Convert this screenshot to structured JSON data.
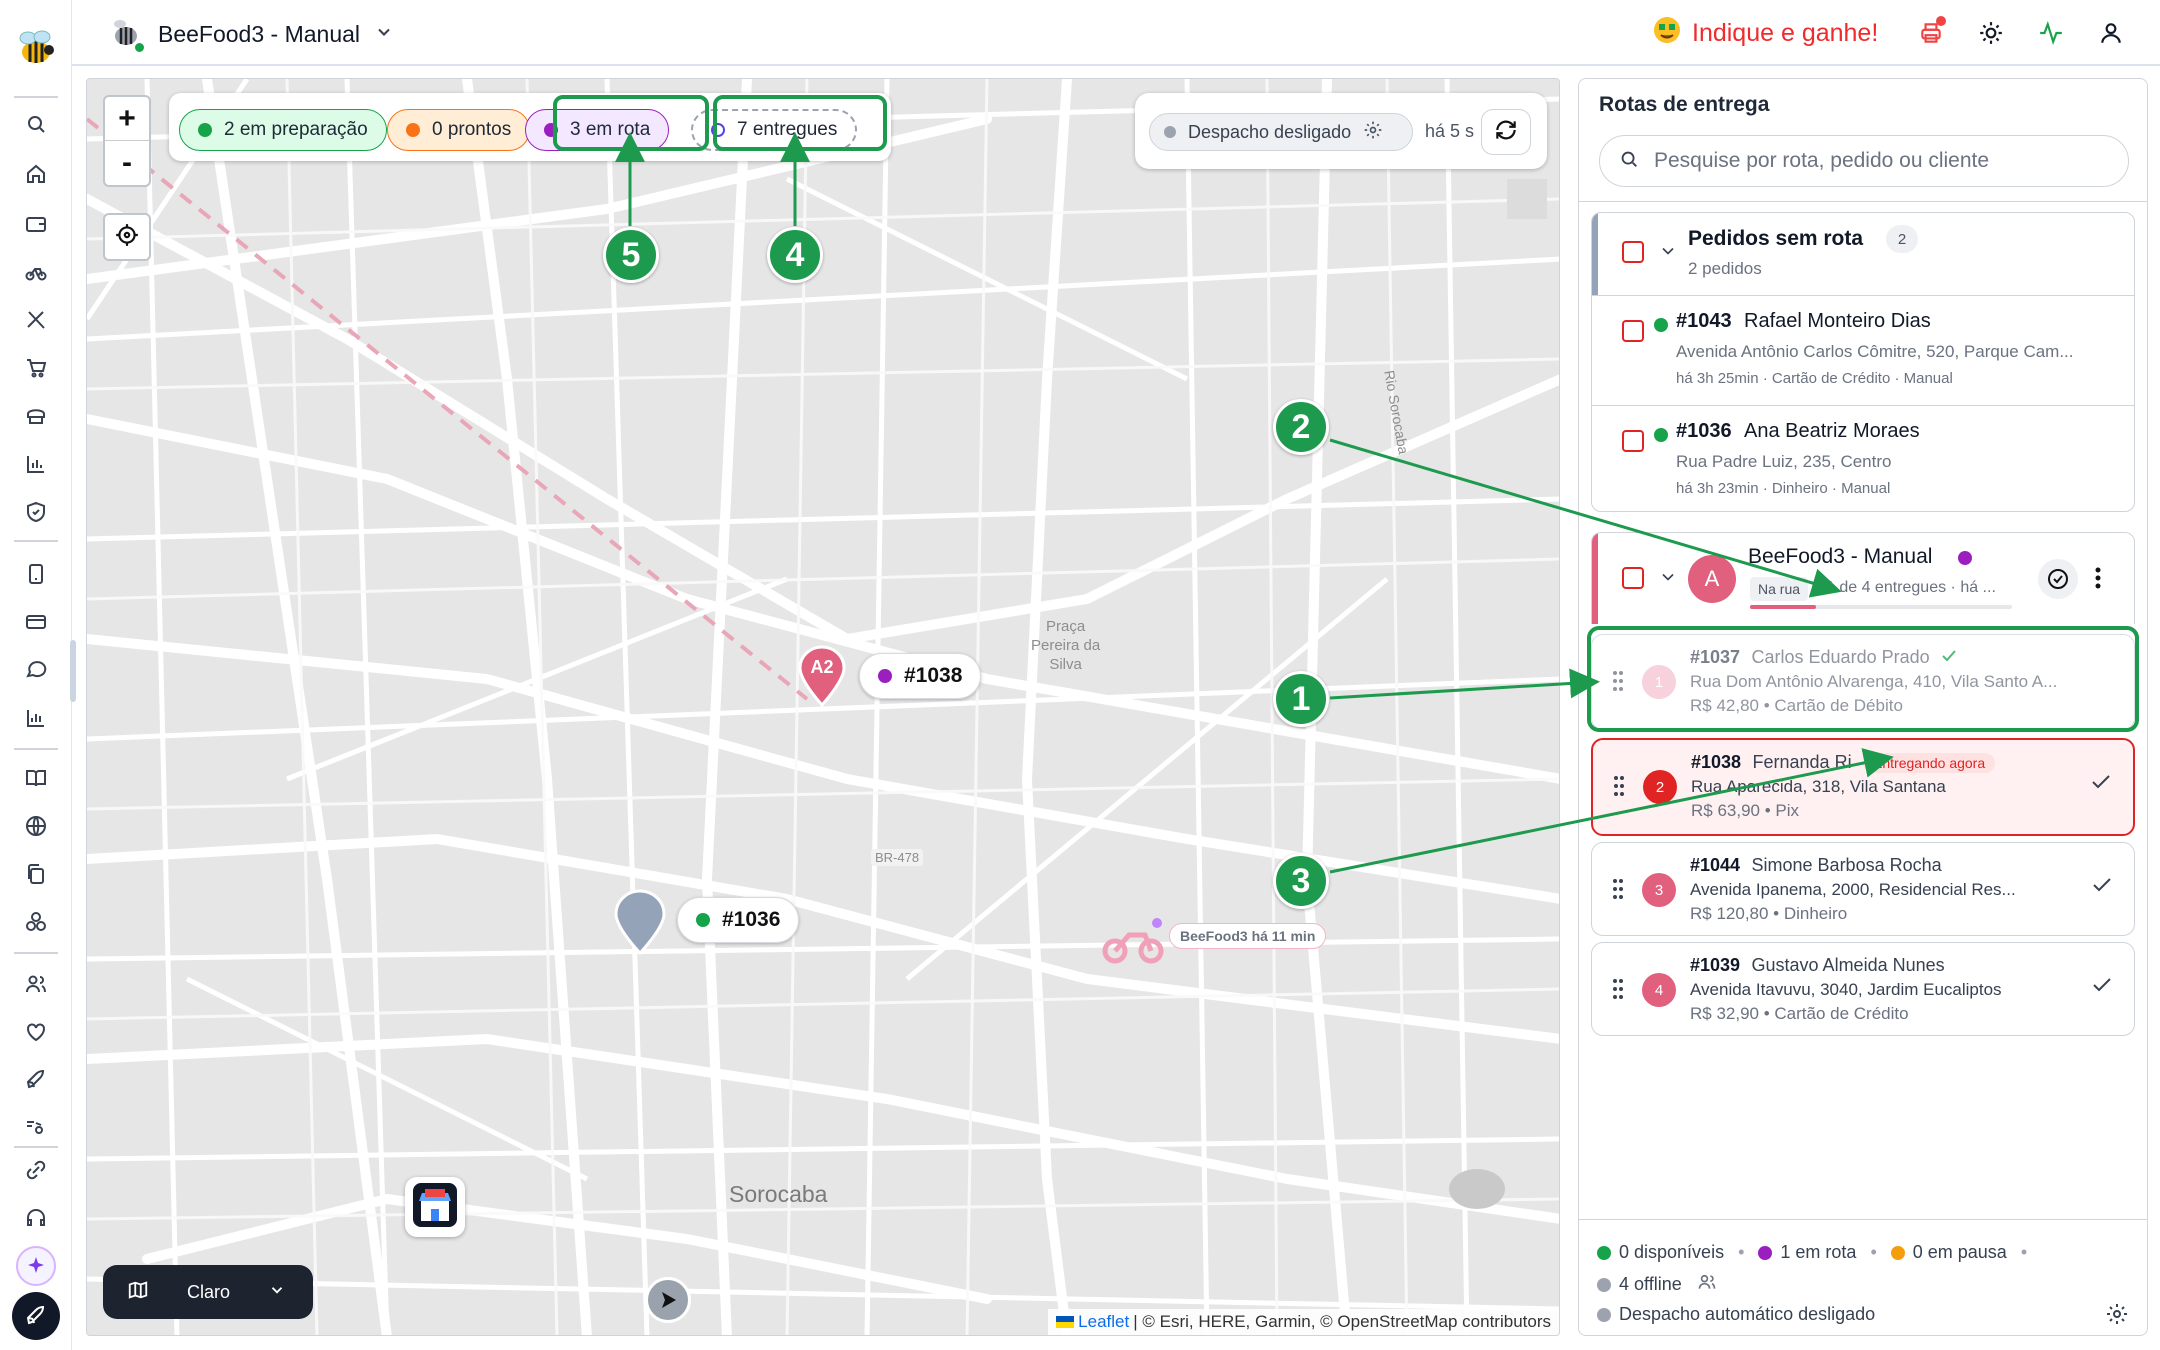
{
  "header": {
    "store_name": "BeeFood3 - Manual",
    "refer_label": "Indique e ganhe!",
    "icons": [
      "printer-icon",
      "sun-icon",
      "activity-icon",
      "user-icon"
    ]
  },
  "sidebar": {
    "items": [
      "search-icon",
      "home-icon",
      "wallet-icon",
      "bike-icon",
      "utensils-icon",
      "cart-icon",
      "chef-hat-icon",
      "bar-chart-icon",
      "shield-icon",
      "tablet-icon",
      "card-icon",
      "chat-icon",
      "chart-icon",
      "book-icon",
      "globe-icon",
      "copy-icon",
      "boxes-icon",
      "users-icon",
      "heart-icon",
      "rocket-icon",
      "bike-wind-icon",
      "link-icon",
      "headset-icon",
      "sparkles-icon",
      "rocket-launch-icon"
    ]
  },
  "map": {
    "zoom_in": "+",
    "zoom_out": "-",
    "filters": [
      {
        "label": "2 em preparação",
        "color": "#16a34a"
      },
      {
        "label": "0 prontos",
        "color": "#f97316"
      },
      {
        "label": "3 em rota",
        "color": "#9b1fbf"
      },
      {
        "label": "7 entregues",
        "color": "#4f46e5"
      }
    ],
    "dispatch_label": "Despacho desligado",
    "dispatch_time": "há 5 s",
    "markers": {
      "a2_label": "A2",
      "order_1038": "#1038",
      "order_1036": "#1036",
      "driver_tag": "BeeFood3 há 11 min"
    },
    "place_labels": {
      "praca": "Praça\nPereira da\nSilva",
      "city": "Sorocaba",
      "road": "BR-478",
      "river": "Rio Sorocaba"
    },
    "theme_label": "Claro",
    "attribution_link": "Leaflet",
    "attribution_text": "| © Esri, HERE, Garmin, © OpenStreetMap contributors"
  },
  "callouts": [
    "1",
    "2",
    "3",
    "4",
    "5"
  ],
  "panel": {
    "title": "Rotas de entrega",
    "search_placeholder": "Pesquise por rota, pedido ou cliente",
    "unrouted": {
      "title": "Pedidos sem rota",
      "count": "2",
      "subtitle": "2 pedidos",
      "orders": [
        {
          "id": "#1043",
          "name": "Rafael Monteiro Dias",
          "address": "Avenida Antônio Carlos Cômitre, 520, Parque Cam...",
          "meta": "há 3h 25min · Cartão de Crédito · Manual"
        },
        {
          "id": "#1036",
          "name": "Ana Beatriz Moraes",
          "address": "Rua Padre Luiz, 235, Centro",
          "meta": "há 3h 23min · Dinheiro · Manual"
        }
      ]
    },
    "route": {
      "avatar": "A",
      "name": "BeeFood3 - Manual",
      "status_badge": "Na rua",
      "status_text": "1 de 4 entregues · há ...",
      "progress": 0.25,
      "stops": [
        {
          "num": "1",
          "id": "#1037",
          "name": "Carlos Eduardo Prado",
          "address": "Rua Dom Antônio Alvarenga, 410, Vila Santo A...",
          "payment": "R$ 42,80 • Cartão de Débito",
          "state": "done"
        },
        {
          "num": "2",
          "id": "#1038",
          "name": "Fernanda Ri",
          "badge": "Entregando agora",
          "address": "Rua Aparecida, 318, Vila Santana",
          "payment": "R$ 63,90 • Pix",
          "state": "current"
        },
        {
          "num": "3",
          "id": "#1044",
          "name": "Simone Barbosa Rocha",
          "address": "Avenida Ipanema, 2000, Residencial Res...",
          "payment": "R$ 120,80 • Dinheiro",
          "state": "pending"
        },
        {
          "num": "4",
          "id": "#1039",
          "name": "Gustavo Almeida Nunes",
          "address": "Avenida Itavuvu, 3040, Jardim Eucaliptos",
          "payment": "R$ 32,90 • Cartão de Crédito",
          "state": "pending"
        }
      ]
    },
    "footer": {
      "available": "0 disponíveis",
      "in_route": "1 em rota",
      "paused": "0 em pausa",
      "offline": "4 offline",
      "auto_dispatch": "Despacho automático desligado"
    }
  },
  "colors": {
    "green": "#1d9a4e",
    "red": "#e02424",
    "purple": "#9b1fbf",
    "pink": "#e0607e"
  }
}
